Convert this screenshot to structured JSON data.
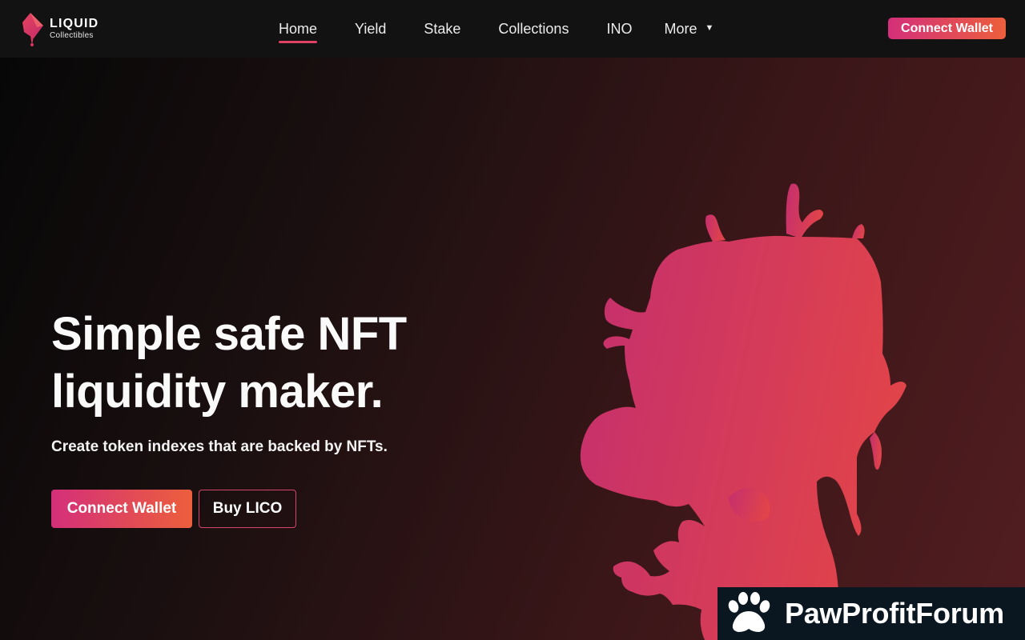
{
  "brand": {
    "name": "LIQUID",
    "tagline": "Collectibles"
  },
  "nav": {
    "items": [
      {
        "label": "Home",
        "active": true
      },
      {
        "label": "Yield",
        "active": false
      },
      {
        "label": "Stake",
        "active": false
      },
      {
        "label": "Collections",
        "active": false
      },
      {
        "label": "INO",
        "active": false
      },
      {
        "label": "More",
        "active": false,
        "icon": "caret-down-icon"
      }
    ],
    "cta_label": "Connect Wallet"
  },
  "hero": {
    "title": "Simple safe NFT liquidity maker.",
    "subtitle": "Create token indexes that are backed by NFTs.",
    "primary_button": "Connect Wallet",
    "secondary_button": "Buy LICO",
    "figure_icon": "character-silhouette-icon"
  },
  "watermark": {
    "text": "PawProfitForum",
    "icon": "paw-icon"
  },
  "colors": {
    "accent_start": "#d42f7a",
    "accent_end": "#ec5f3c",
    "nav_bg": "#121212",
    "active_underline": "#e04266"
  }
}
